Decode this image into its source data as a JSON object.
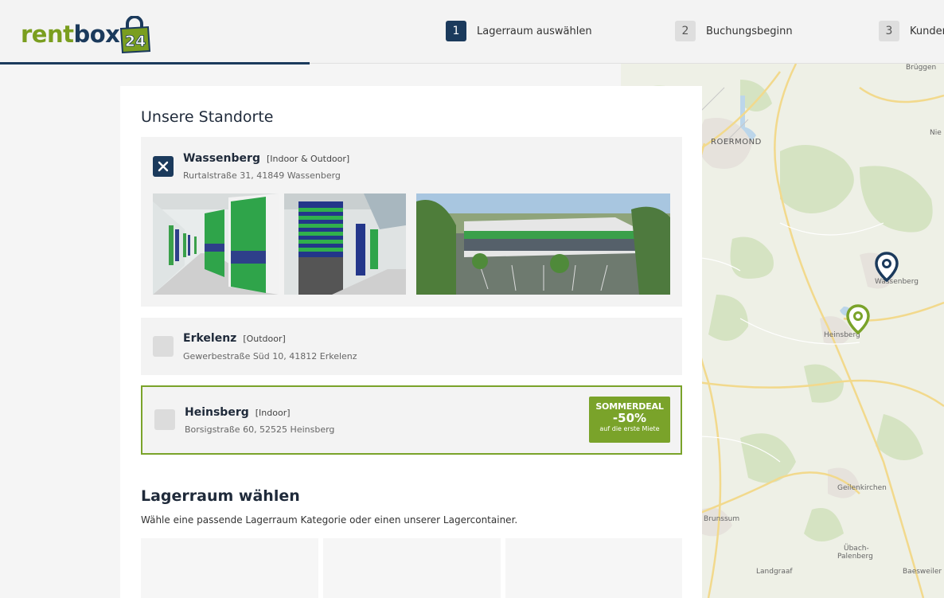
{
  "brand": {
    "part1": "rent",
    "part2": "box",
    "badge": "24",
    "colors": {
      "green": "#7a9e1f",
      "navy": "#1b3a5c"
    }
  },
  "steps": [
    {
      "num": "1",
      "label": "Lagerraum auswählen",
      "active": true
    },
    {
      "num": "2",
      "label": "Buchungsbeginn",
      "active": false
    },
    {
      "num": "3",
      "label": "Kunden",
      "active": false
    }
  ],
  "locations_section": {
    "title": "Unsere Standorte"
  },
  "locations": [
    {
      "name": "Wassenberg",
      "tag": "[Indoor & Outdoor]",
      "address": "Rurtalstraße 31, 41849 Wassenberg",
      "selected": true
    },
    {
      "name": "Erkelenz",
      "tag": "[Outdoor]",
      "address": "Gewerbestraße Süd 10, 41812 Erkelenz",
      "selected": false
    },
    {
      "name": "Heinsberg",
      "tag": "[Indoor]",
      "address": "Borsigstraße 60, 52525 Heinsberg",
      "selected": false,
      "deal": {
        "title": "SOMMERDEAL",
        "value": "-50%",
        "subtitle": "auf die erste Miete"
      }
    }
  ],
  "storage_section": {
    "title": "Lagerraum wählen",
    "subtitle": "Wähle eine passende Lagerraum Kategorie oder einen unserer Lagercontainer."
  },
  "map": {
    "labels": [
      "Brüggen",
      "ROERMOND",
      "Nie",
      "Wassenberg",
      "Heinsberg",
      "Geilenkirchen",
      "Brunssum",
      "Übach-",
      "Palenberg",
      "Landgraaf",
      "Baesweiler"
    ],
    "pins": [
      {
        "name": "Wassenberg",
        "color": "#1b3a5c",
        "icon": "map-pin-icon"
      },
      {
        "name": "Heinsberg",
        "color": "#7aa32a",
        "icon": "map-pin-icon"
      }
    ]
  }
}
